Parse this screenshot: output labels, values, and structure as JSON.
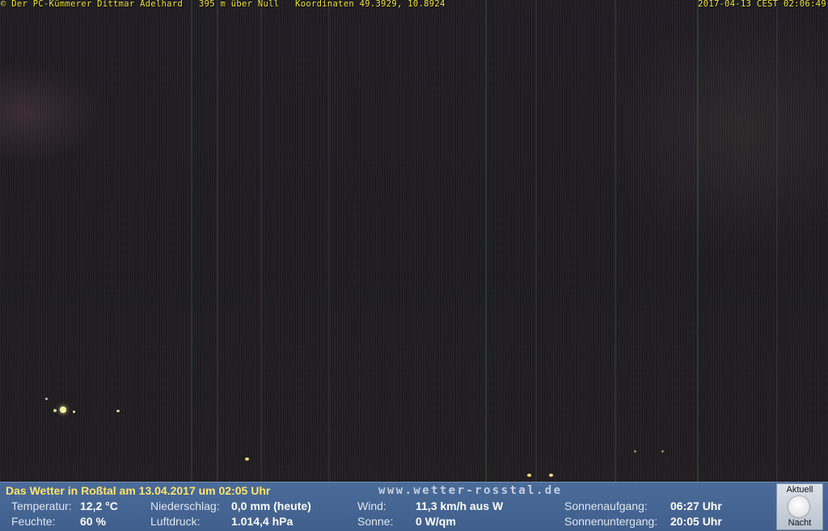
{
  "overlay": {
    "left_text": "© Der PC-Kümmerer Dittmar Adelhard   395 m über Null   Koordinaten 49.3929, 10.8924",
    "timestamp": "2017-04-13 CEST 02:06:49"
  },
  "weather_panel": {
    "title": "Das Wetter in Roßtal am 13.04.2017 um 02:05 Uhr",
    "url": "www.wetter-rosstal.de",
    "temperature": {
      "label": "Temperatur:",
      "value": "12,2 °C"
    },
    "humidity": {
      "label": "Feuchte:",
      "value": "60 %"
    },
    "precipitation": {
      "label": "Niederschlag:",
      "value": "0,0 mm (heute)"
    },
    "pressure": {
      "label": "Luftdruck:",
      "value": "1.014,4 hPa"
    },
    "wind": {
      "label": "Wind:",
      "value": "11,3 km/h aus W"
    },
    "sun": {
      "label": "Sonne:",
      "value": "0 W/qm"
    },
    "sunrise": {
      "label": "Sonnenaufgang:",
      "value": "06:27 Uhr"
    },
    "sunset": {
      "label": "Sonnenuntergang:",
      "value": "20:05 Uhr"
    },
    "moon": {
      "top_label": "Aktuell",
      "bottom_label": "Nacht",
      "icon": "moon-icon"
    }
  },
  "colors": {
    "overlay_text": "#f2e33d",
    "panel_bg": "#4a6b99",
    "panel_title": "#ffe46a"
  }
}
